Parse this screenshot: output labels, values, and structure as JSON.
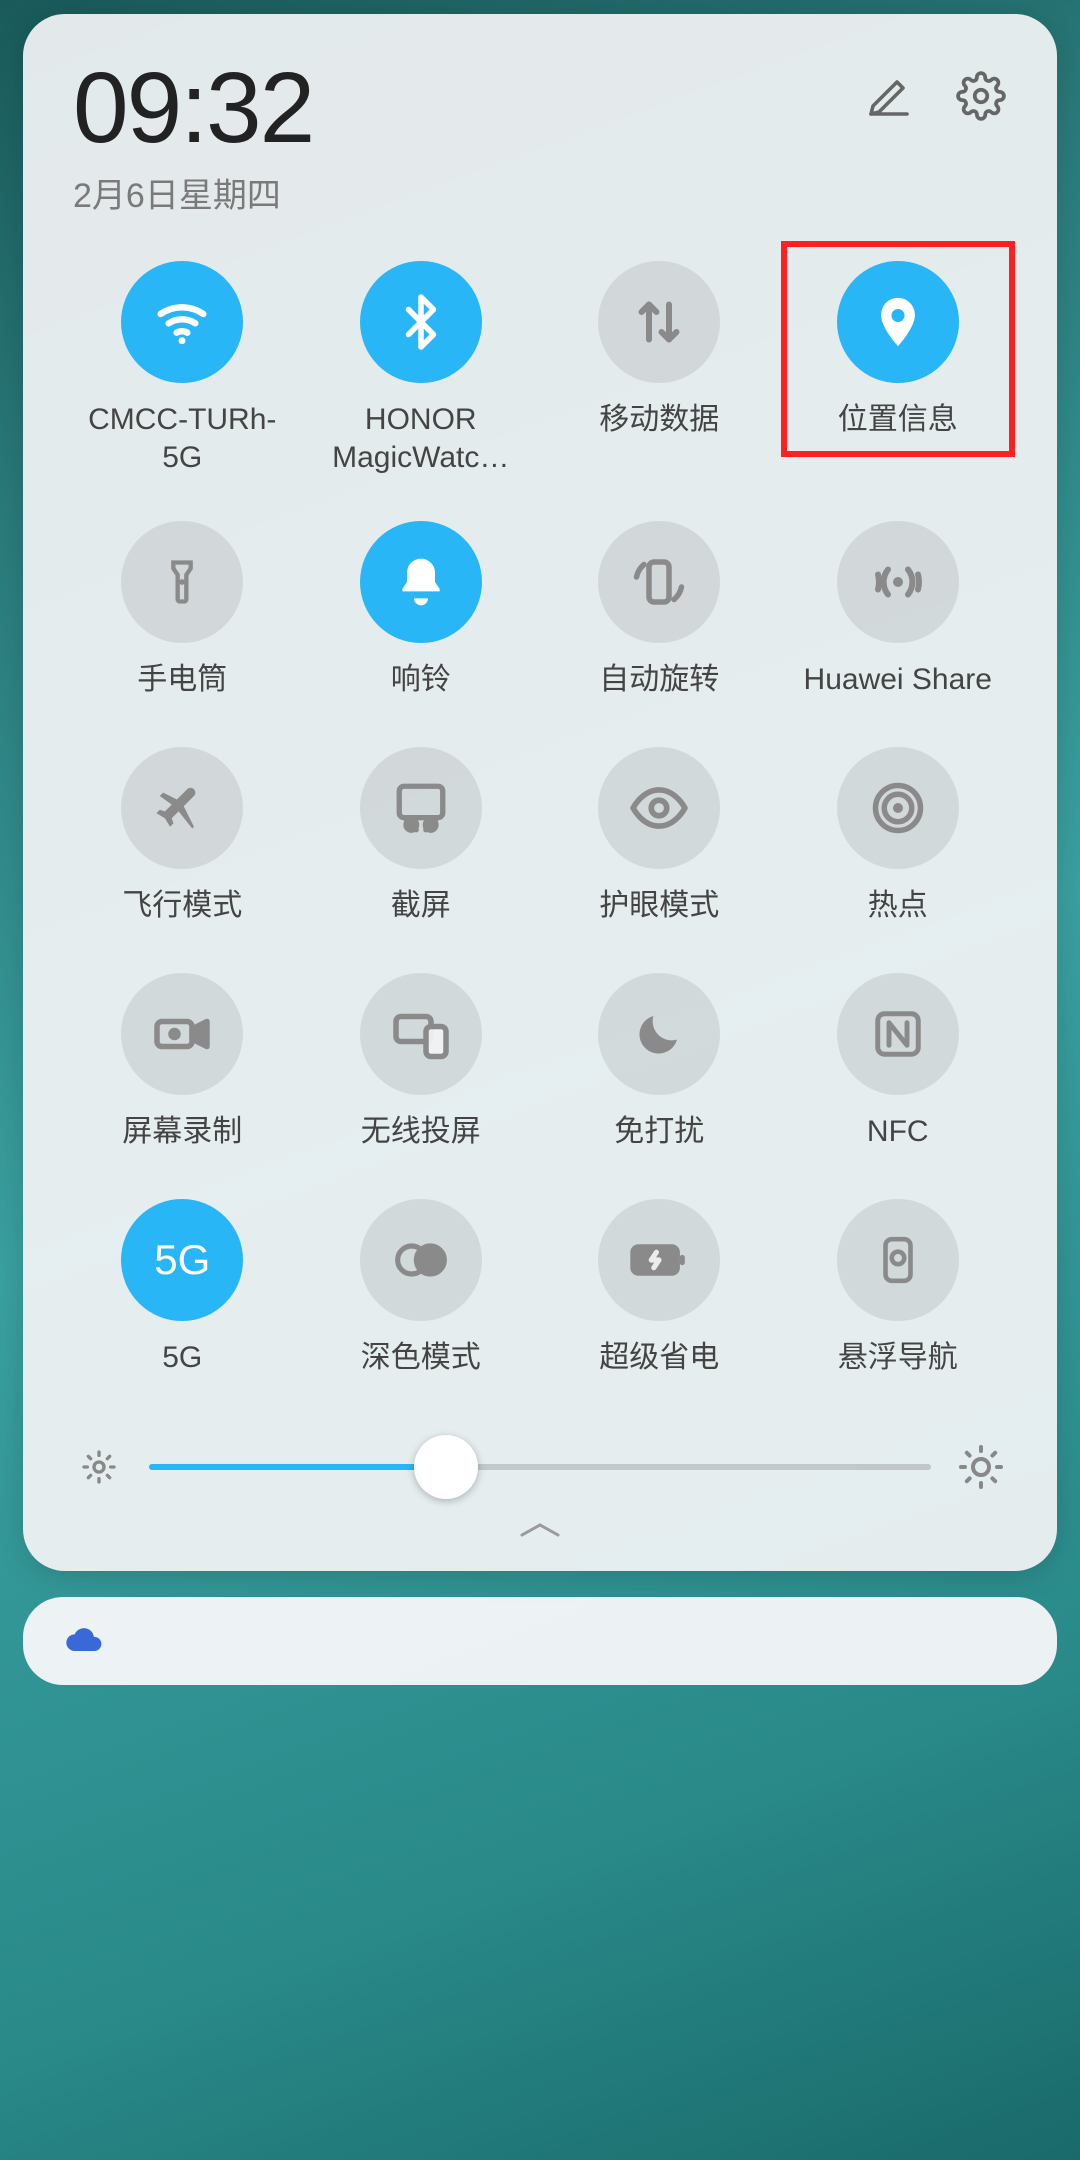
{
  "header": {
    "time": "09:32",
    "date": "2月6日星期四"
  },
  "tiles": [
    {
      "label": "CMCC-TURh-5G",
      "icon": "wifi",
      "active": true
    },
    {
      "label": "HONOR MagicWatc…",
      "icon": "bluetooth",
      "active": true
    },
    {
      "label": "移动数据",
      "icon": "mobile-data",
      "active": false
    },
    {
      "label": "位置信息",
      "icon": "location",
      "active": true,
      "highlighted": true
    },
    {
      "label": "手电筒",
      "icon": "flashlight",
      "active": false
    },
    {
      "label": "响铃",
      "icon": "bell",
      "active": true
    },
    {
      "label": "自动旋转",
      "icon": "rotate",
      "active": false
    },
    {
      "label": "Huawei Share",
      "icon": "share",
      "active": false
    },
    {
      "label": "飞行模式",
      "icon": "airplane",
      "active": false
    },
    {
      "label": "截屏",
      "icon": "screenshot",
      "active": false
    },
    {
      "label": "护眼模式",
      "icon": "eye",
      "active": false
    },
    {
      "label": "热点",
      "icon": "hotspot",
      "active": false
    },
    {
      "label": "屏幕录制",
      "icon": "record",
      "active": false
    },
    {
      "label": "无线投屏",
      "icon": "cast",
      "active": false
    },
    {
      "label": "免打扰",
      "icon": "dnd",
      "active": false
    },
    {
      "label": "NFC",
      "icon": "nfc",
      "active": false
    },
    {
      "label": "5G",
      "icon": "5g",
      "active": true
    },
    {
      "label": "深色模式",
      "icon": "dark",
      "active": false
    },
    {
      "label": "超级省电",
      "icon": "battery",
      "active": false
    },
    {
      "label": "悬浮导航",
      "icon": "floatnav",
      "active": false
    }
  ],
  "brightness": {
    "percent": 38
  },
  "colors": {
    "accent": "#29b6f6",
    "highlight": "#ff2020"
  }
}
